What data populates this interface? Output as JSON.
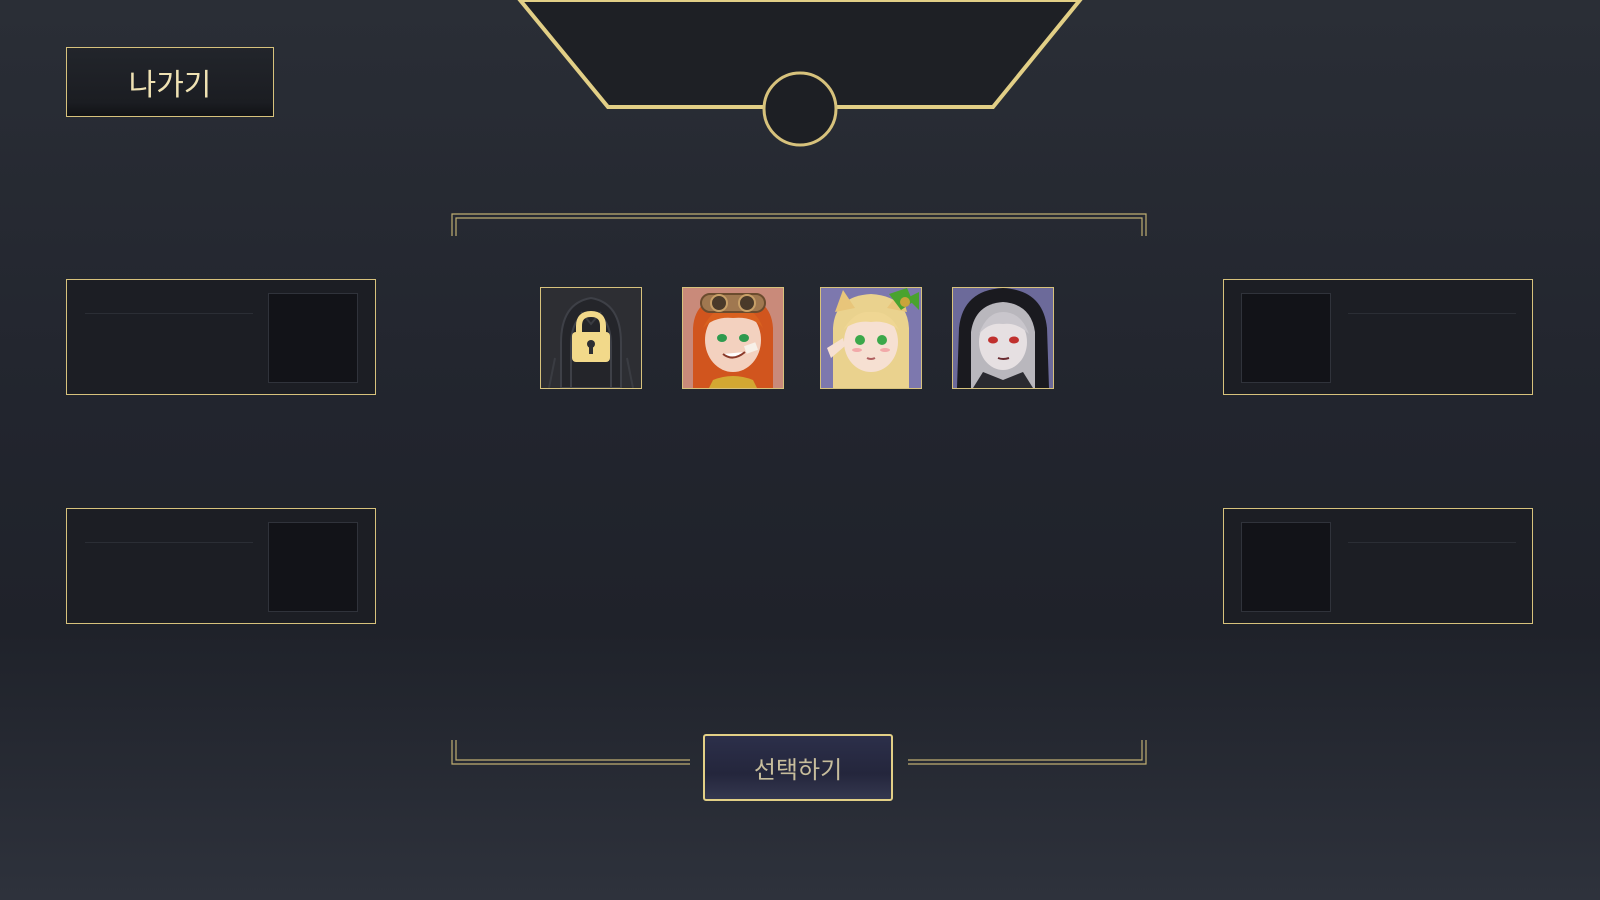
{
  "header": {
    "exit_label": "나가기"
  },
  "slots": {
    "left_top": {
      "state": "empty"
    },
    "left_bottom": {
      "state": "empty"
    },
    "right_top": {
      "state": "empty"
    },
    "right_bottom": {
      "state": "empty"
    }
  },
  "characters": [
    {
      "name": "locked-character",
      "locked": true,
      "icon": "lock-icon"
    },
    {
      "name": "red-haired-goggles-girl",
      "locked": false
    },
    {
      "name": "blonde-cat-ear-girl",
      "locked": false
    },
    {
      "name": "hooded-dark-girl",
      "locked": false
    }
  ],
  "footer": {
    "select_label": "선택하기"
  },
  "colors": {
    "gold": "#d7c27c",
    "background": "#22252e",
    "button_fill": "#2a2d46"
  }
}
